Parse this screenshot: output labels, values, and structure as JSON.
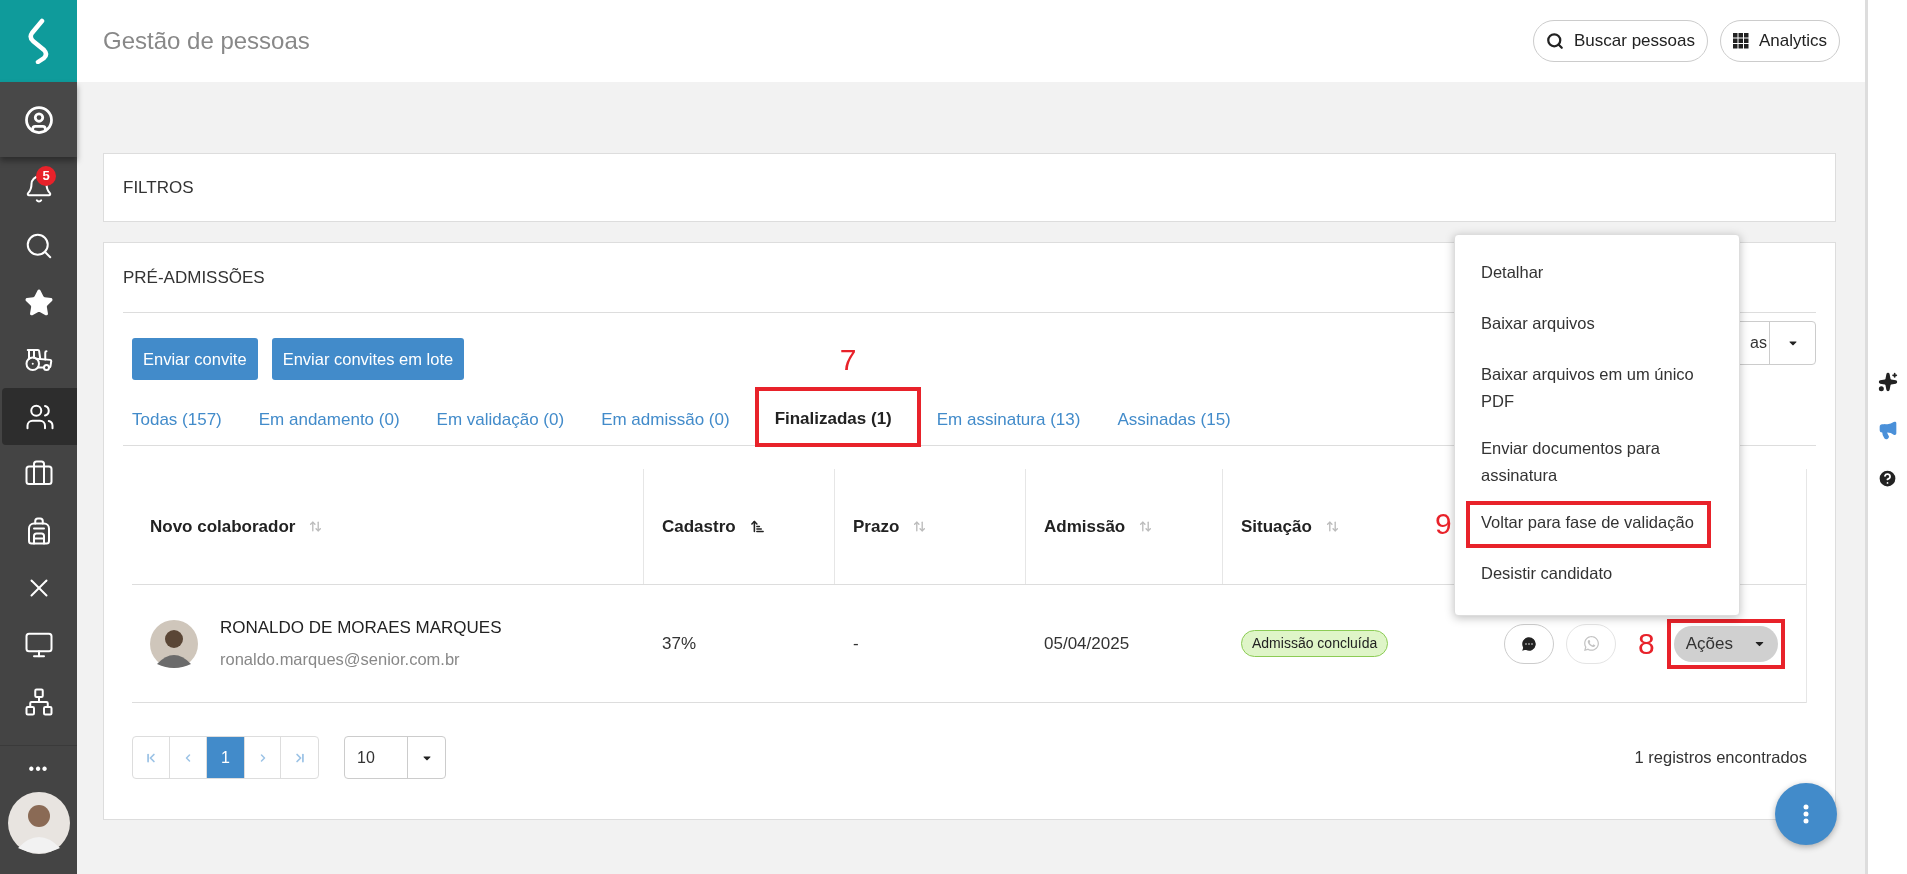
{
  "header": {
    "title": "Gestão de pessoas",
    "buttons": [
      {
        "kind": "search",
        "label": "Buscar pessoas"
      },
      {
        "kind": "grid",
        "label": "Analytics"
      }
    ]
  },
  "sidebar": {
    "profile": {
      "kind": "user"
    },
    "items": [
      {
        "kind": "bell",
        "badge": "5",
        "selected": false
      },
      {
        "kind": "search",
        "selected": false
      },
      {
        "kind": "star",
        "selected": false
      },
      {
        "kind": "tractor",
        "selected": false
      },
      {
        "kind": "users",
        "selected": true
      },
      {
        "kind": "briefcase",
        "selected": false
      },
      {
        "kind": "backpack",
        "selected": false
      },
      {
        "kind": "x",
        "selected": false
      },
      {
        "kind": "monitor",
        "selected": false
      },
      {
        "kind": "network",
        "selected": false
      }
    ],
    "more": "•••"
  },
  "right_panel": {
    "icons": [
      {
        "kind": "sparkles"
      },
      {
        "kind": "megaphone"
      },
      {
        "kind": "help"
      }
    ]
  },
  "filters": {
    "title": "FILTROS"
  },
  "pre_admissions": {
    "title": "PRÉ-ADMISSÕES",
    "buttons": [
      "Enviar convite",
      "Enviar convites em lote"
    ],
    "split_button": {
      "label": "as"
    },
    "tabs": [
      {
        "label": "Todas (157)",
        "selected": false
      },
      {
        "label": "Em andamento (0)",
        "selected": false
      },
      {
        "label": "Em validação (0)",
        "selected": false
      },
      {
        "label": "Em admissão (0)",
        "selected": false
      },
      {
        "label": "Finalizadas (1)",
        "selected": true,
        "marker": "7"
      },
      {
        "label": "Em assinatura (13)",
        "selected": false
      },
      {
        "label": "Assinadas (15)",
        "selected": false
      }
    ],
    "table": {
      "columns": [
        {
          "label": "Novo colaborador",
          "sorted": false
        },
        {
          "label": "Cadastro",
          "sorted": true
        },
        {
          "label": "Prazo",
          "sorted": false
        },
        {
          "label": "Admissão",
          "sorted": false
        },
        {
          "label": "Situação",
          "sorted": false
        }
      ],
      "rows": [
        {
          "name": "RONALDO DE MORAES MARQUES",
          "email": "ronaldo.marques@senior.com.br",
          "cadastro": "37%",
          "prazo": "-",
          "admissao": "05/04/2025",
          "situacao": "Admissão concluída",
          "whatsapp_disabled": true,
          "actions": {
            "label": "Ações",
            "marker": "8"
          }
        }
      ]
    },
    "menu": [
      {
        "label": "Detalhar"
      },
      {
        "label": "Baixar arquivos"
      },
      {
        "label": "Baixar arquivos em um único PDF"
      },
      {
        "label": "Enviar documentos para assinatura"
      },
      {
        "label": "Voltar para fase de validação",
        "marker": "9"
      },
      {
        "label": "Desistir candidato"
      }
    ],
    "pagination": {
      "pages": [
        {
          "label": "1",
          "selected": true
        }
      ],
      "page_size": "10",
      "records": "1 registros encontrados"
    }
  }
}
